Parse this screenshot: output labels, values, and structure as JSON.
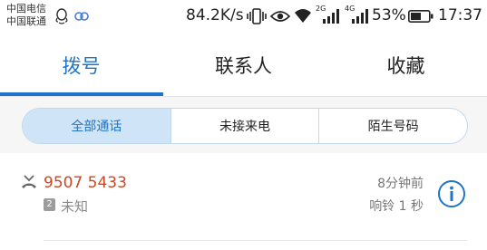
{
  "status_bar": {
    "carrier_1": "中国电信",
    "carrier_2": "中国联通",
    "net_speed": "84.2K/s",
    "network_1": "2G",
    "network_2": "4G",
    "battery": "53%",
    "time": "17:37",
    "icons": [
      "qq-icon",
      "app-icon",
      "vibrate-icon",
      "eye-comfort-icon",
      "wifi-icon",
      "signal-icon",
      "battery-icon"
    ]
  },
  "tabs": [
    {
      "label": "拨号",
      "active": true
    },
    {
      "label": "联系人",
      "active": false
    },
    {
      "label": "收藏",
      "active": false
    }
  ],
  "filters": [
    {
      "label": "全部通话",
      "active": true
    },
    {
      "label": "未接来电",
      "active": false
    },
    {
      "label": "陌生号码",
      "active": false
    }
  ],
  "calls": [
    {
      "number": "9507 5433",
      "sim": "2",
      "location": "未知",
      "time": "8分钟前",
      "ring": "响铃 1 秒",
      "type": "missed"
    }
  ],
  "colors": {
    "accent": "#1f74c9",
    "missed": "#d2451f",
    "segment_active_bg": "#cfe4f7"
  }
}
